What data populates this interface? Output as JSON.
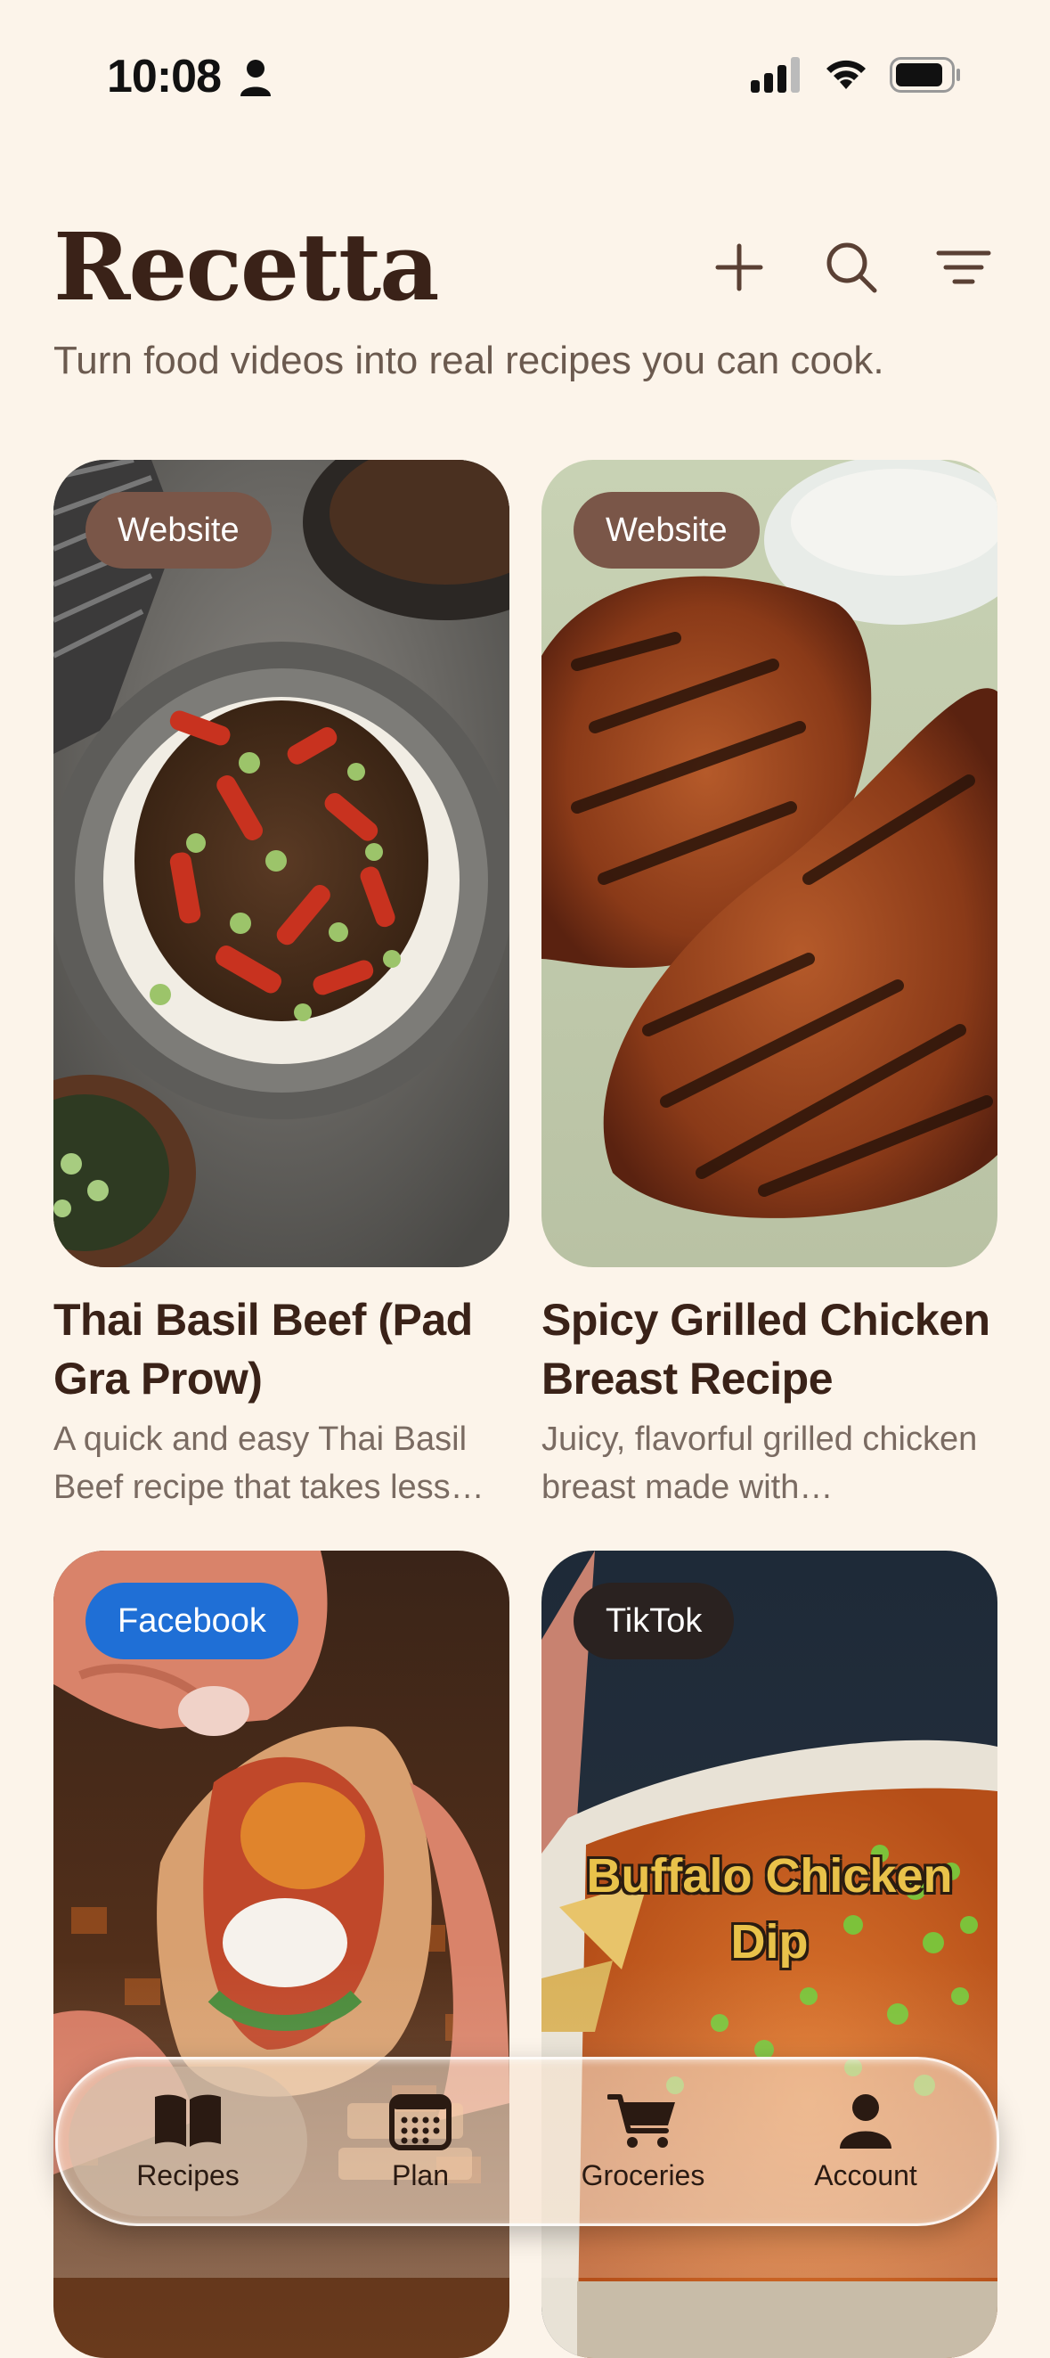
{
  "status_bar": {
    "time": "10:08",
    "icons": [
      "person-icon",
      "signal-icon",
      "wifi-icon",
      "battery-icon"
    ]
  },
  "header": {
    "app_title": "Recetta",
    "subtitle": "Turn food videos into real recipes you can cook.",
    "actions": [
      "plus-icon",
      "search-icon",
      "filter-icon"
    ]
  },
  "recipes": [
    {
      "source": "Website",
      "title": "Thai Basil Beef (Pad Gra Prow)",
      "description": "A quick and easy Thai Basil Beef recipe that takes less…"
    },
    {
      "source": "Website",
      "title": "Spicy Grilled Chicken Breast Recipe",
      "description": "Juicy, flavorful grilled chicken breast made with…"
    },
    {
      "source": "Facebook",
      "title": "",
      "description": ""
    },
    {
      "source": "TikTok",
      "overlay_line1": "Buffalo Chicken",
      "overlay_line2": "Dip"
    }
  ],
  "tab_bar": {
    "tabs": [
      {
        "label": "Recipes",
        "icon": "book-icon",
        "active": true
      },
      {
        "label": "Plan",
        "icon": "calendar-icon",
        "active": false
      },
      {
        "label": "Groceries",
        "icon": "cart-icon",
        "active": false
      },
      {
        "label": "Account",
        "icon": "person-icon",
        "active": false
      }
    ]
  },
  "colors": {
    "background": "#fcf4ea",
    "title": "#3a2218",
    "badge_website": "#7a5648",
    "badge_facebook": "#1f6fd6",
    "badge_tiktok": "#2a2220"
  }
}
